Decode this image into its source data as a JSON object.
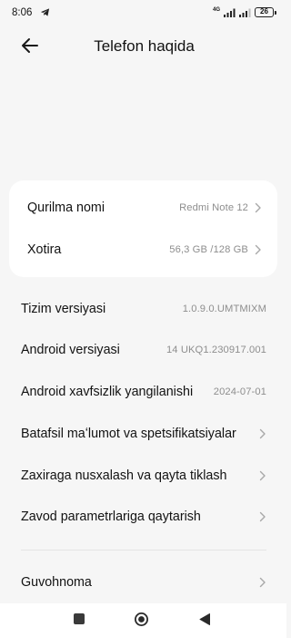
{
  "status_bar": {
    "time": "8:06",
    "network_tag": "4G",
    "battery": "26"
  },
  "header": {
    "title": "Telefon haqida"
  },
  "device_card": [
    {
      "label": "Qurilma nomi",
      "value": "Redmi Note 12"
    },
    {
      "label": "Xotira",
      "value": "56,3 GB /128 GB"
    }
  ],
  "info_rows": [
    {
      "label": "Tizim versiyasi",
      "value": "1.0.9.0.UMTMIXM"
    },
    {
      "label": "Android versiyasi",
      "value": "14 UKQ1.230917.001"
    },
    {
      "label": "Android xavfsizlik yangilanishi",
      "value": "2024-07-01"
    }
  ],
  "link_rows": [
    {
      "label": "Batafsil maʻlumot va spetsifikatsiyalar"
    },
    {
      "label": "Zaxiraga nusxalash va qayta tiklash"
    },
    {
      "label": "Zavod parametrlariga qaytarish"
    },
    {
      "label": "Guvohnoma"
    }
  ],
  "colors": {
    "background": "#f6f6f6",
    "card": "#ffffff",
    "secondary_text": "#8e8e8e",
    "chevron": "#a8a8a8"
  },
  "icons": {
    "back": "arrow-left-icon",
    "chevron": "chevron-right-icon",
    "nav_recent": "square-icon",
    "nav_home": "circle-icon",
    "nav_back": "triangle-back-icon"
  }
}
